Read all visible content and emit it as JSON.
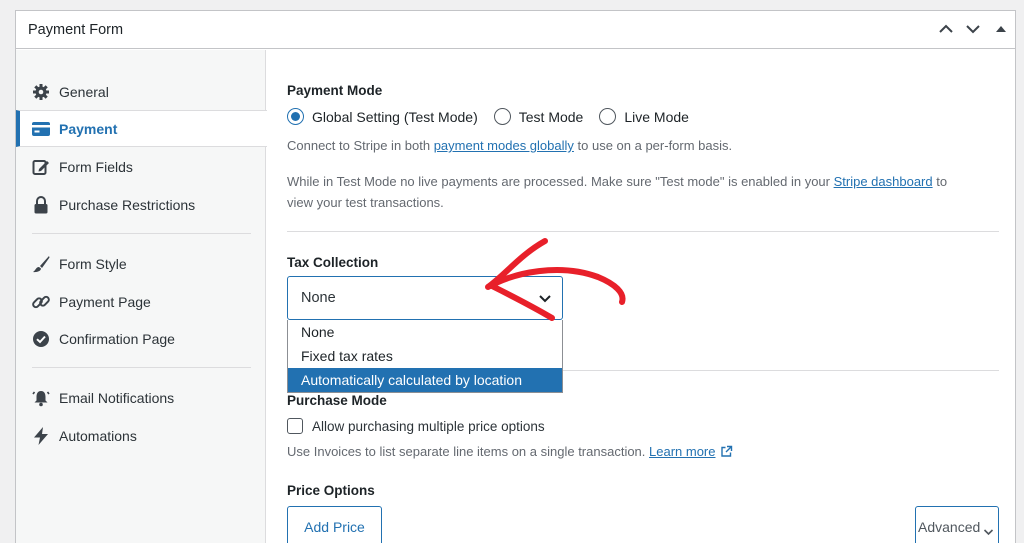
{
  "header": {
    "title": "Payment Form"
  },
  "sidebar": {
    "items": [
      {
        "label": "General",
        "icon": "gear-icon"
      },
      {
        "label": "Payment",
        "icon": "credit-card-icon",
        "active": true
      },
      {
        "label": "Form Fields",
        "icon": "edit-icon"
      },
      {
        "label": "Purchase Restrictions",
        "icon": "lock-icon"
      },
      {
        "label": "Form Style",
        "icon": "paintbrush-icon"
      },
      {
        "label": "Payment Page",
        "icon": "link-icon"
      },
      {
        "label": "Confirmation Page",
        "icon": "check-circle-icon"
      },
      {
        "label": "Email Notifications",
        "icon": "bell-icon"
      },
      {
        "label": "Automations",
        "icon": "bolt-icon"
      }
    ]
  },
  "payment_mode": {
    "label": "Payment Mode",
    "options": [
      "Global Setting (Test Mode)",
      "Test Mode",
      "Live Mode"
    ],
    "selected": "Global Setting (Test Mode)",
    "connect_prefix": "Connect to Stripe in both ",
    "connect_link": "payment modes globally",
    "connect_suffix": " to use on a per-form basis.",
    "test_note_prefix": "While in Test Mode no live payments are processed. Make sure \"Test mode\" is enabled in your ",
    "test_note_link": "Stripe dashboard",
    "test_note_suffix": " to",
    "test_note_line2": "view your test transactions."
  },
  "tax_collection": {
    "label": "Tax Collection",
    "selected": "None",
    "options": [
      "None",
      "Fixed tax rates",
      "Automatically calculated by location"
    ],
    "highlighted": "Automatically calculated by location"
  },
  "purchase_mode": {
    "label": "Purchase Mode",
    "checkbox_label": "Allow purchasing multiple price options",
    "desc": "Use Invoices to list separate line items on a single transaction. ",
    "learn_more": "Learn more"
  },
  "price_options": {
    "label": "Price Options",
    "add_price": "Add Price",
    "advanced": "Advanced"
  },
  "colors": {
    "accent": "#2271b1",
    "annotation_arrow": "#e8202a"
  }
}
